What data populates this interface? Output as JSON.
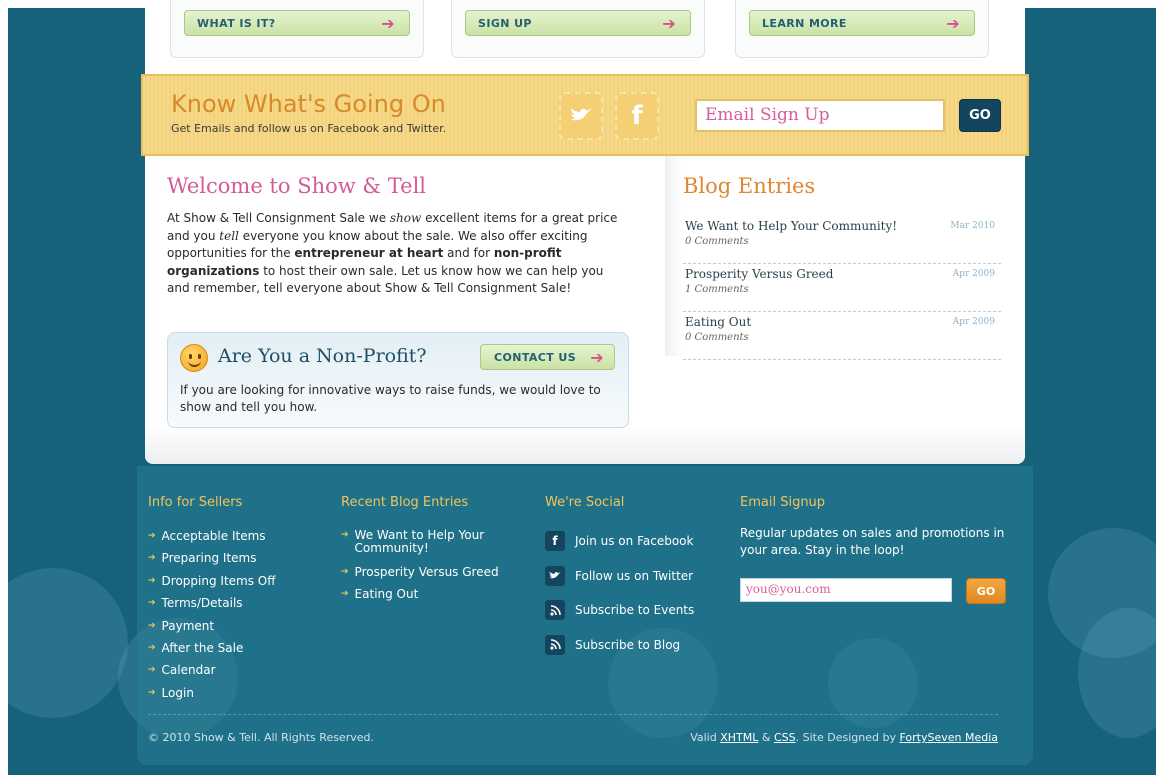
{
  "colors": {
    "background_teal": "#16627a",
    "pink_heading": "#d35c96",
    "orange_heading": "#df8630",
    "banner_yellow": "#f6d98a",
    "green_button": "#c9e2a5",
    "navy_button": "#13465e",
    "footer_heading": "#f0c45a"
  },
  "cta_buttons": [
    {
      "label": "WHAT IS IT?",
      "icon": "arrow-right-icon"
    },
    {
      "label": "SIGN UP",
      "icon": "arrow-right-icon"
    },
    {
      "label": "LEARN MORE",
      "icon": "arrow-right-icon"
    }
  ],
  "banner": {
    "title": "Know What's Going On",
    "subtitle": "Get Emails and follow us on Facebook and Twitter.",
    "twitter_icon": "twitter-bird-icon",
    "facebook_icon": "facebook-icon",
    "email_placeholder": "Email Sign Up",
    "go_label": "GO"
  },
  "welcome": {
    "title": "Welcome to Show & Tell",
    "p1": "At Show & Tell Consignment Sale we ",
    "em1": "show",
    "p2": " excellent items for a great price and you ",
    "em2": "tell",
    "p3": " everyone you know about the sale. We also offer exciting opportunities for the ",
    "b1": "entrepreneur at heart",
    "p4": " and for ",
    "b2": "non-profit organizations",
    "p5": " to host their own sale. Let us know how we can help you and remember, tell everyone about Show & Tell Consignment Sale!"
  },
  "nonprofit": {
    "icon": "smiley-icon",
    "title": "Are You a Non-Profit?",
    "button_label": "CONTACT US",
    "text": "If you are looking for innovative ways to raise funds, we would love to show and tell you how."
  },
  "blog": {
    "title": "Blog Entries",
    "entries": [
      {
        "title": "We Want to Help Your Community!",
        "comments": "0 Comments",
        "date": "Mar 2010"
      },
      {
        "title": "Prosperity Versus Greed",
        "comments": "1 Comments",
        "date": "Apr 2009"
      },
      {
        "title": "Eating Out",
        "comments": "0 Comments",
        "date": "Apr 2009"
      }
    ]
  },
  "footer": {
    "sellers": {
      "title": "Info for Sellers",
      "links": [
        "Acceptable Items",
        "Preparing Items",
        "Dropping Items Off",
        "Terms/Details",
        "Payment",
        "After the Sale",
        "Calendar",
        "Login"
      ]
    },
    "recent": {
      "title": "Recent Blog Entries",
      "links": [
        "We Want to Help Your Community!",
        "Prosperity Versus Greed",
        "Eating Out"
      ]
    },
    "social": {
      "title": "We're Social",
      "links": [
        {
          "label": "Join us on Facebook",
          "icon": "facebook-icon"
        },
        {
          "label": "Follow us on Twitter",
          "icon": "twitter-bird-icon"
        },
        {
          "label": "Subscribe to Events",
          "icon": "rss-icon"
        },
        {
          "label": "Subscribe to Blog",
          "icon": "rss-icon"
        }
      ]
    },
    "email": {
      "title": "Email Signup",
      "text": "Regular updates on sales and promotions in your area. Stay in the loop!",
      "input_value": "you@you.com",
      "go_label": "GO"
    },
    "copyright": "© 2010 Show & Tell. All Rights Reserved.",
    "credits": {
      "valid": "Valid ",
      "xhtml": "XHTML",
      "amp": " & ",
      "css": "CSS",
      "designed": ". Site Designed by ",
      "designer": "FortySeven Media"
    }
  }
}
